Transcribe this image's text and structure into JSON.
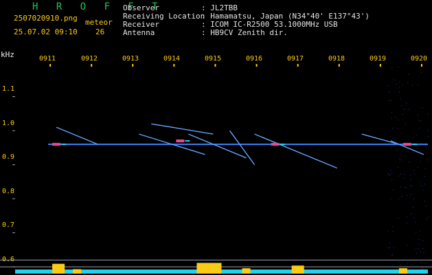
{
  "header": {
    "brand": "H R O F F T",
    "filename": "2507020910.png",
    "datetime": "25.07.02 09:10",
    "meteor_label": "meteor",
    "meteor_count": "26",
    "info_labels": [
      "Observer",
      "Receiving Location",
      "Receiver",
      "Antenna"
    ],
    "info_values": [
      ": JL2TBB",
      ": Hamamatsu, Japan (N34°40' E137°43')",
      ": ICOM IC-R2500 53.1000MHz USB",
      ": HB9CV Zenith dir."
    ]
  },
  "chart_data": {
    "type": "heatmap",
    "ylabel": "kHz",
    "xlabel": "",
    "time_labels": [
      "0911",
      "0912",
      "0913",
      "0914",
      "0915",
      "0916",
      "0917",
      "0918",
      "0919",
      "0920"
    ],
    "y_ticks": [
      "1.1",
      "1.0",
      "0.9",
      "0.8",
      "0.7",
      "0.6"
    ],
    "y_values": [
      1.1,
      1.0,
      0.9,
      0.8,
      0.7,
      0.6
    ],
    "ylim": [
      0.58,
      1.19
    ],
    "carrier_khz": 0.96,
    "meteor_traces": [
      {
        "t0": 0.1,
        "f0": 1.01,
        "t1": 0.2,
        "f1": 0.96
      },
      {
        "t0": 0.3,
        "f0": 0.99,
        "t1": 0.46,
        "f1": 0.93
      },
      {
        "t0": 0.33,
        "f0": 1.02,
        "t1": 0.48,
        "f1": 0.99
      },
      {
        "t0": 0.42,
        "f0": 0.99,
        "t1": 0.56,
        "f1": 0.92
      },
      {
        "t0": 0.52,
        "f0": 1.0,
        "t1": 0.58,
        "f1": 0.9
      },
      {
        "t0": 0.58,
        "f0": 0.99,
        "t1": 0.78,
        "f1": 0.89
      },
      {
        "t0": 0.84,
        "f0": 0.99,
        "t1": 0.93,
        "f1": 0.96
      },
      {
        "t0": 0.91,
        "f0": 0.97,
        "t1": 0.99,
        "f1": 0.93
      }
    ],
    "activity_bursts": [
      {
        "t": 0.09,
        "w": 0.03,
        "level": 0.55
      },
      {
        "t": 0.14,
        "w": 0.02,
        "level": 0.25
      },
      {
        "t": 0.44,
        "w": 0.06,
        "level": 0.6
      },
      {
        "t": 0.55,
        "w": 0.02,
        "level": 0.3
      },
      {
        "t": 0.67,
        "w": 0.03,
        "level": 0.45
      },
      {
        "t": 0.93,
        "w": 0.02,
        "level": 0.3
      }
    ],
    "colors": {
      "carrier": "#3b82f6",
      "noise": "#1e3a8a",
      "trace": "#60a5fa",
      "hot": "#ec4899",
      "warm": "#22d3ee",
      "bars": "#facc15",
      "baseline": "#22d3ee",
      "grid": "#9ca3af"
    }
  }
}
